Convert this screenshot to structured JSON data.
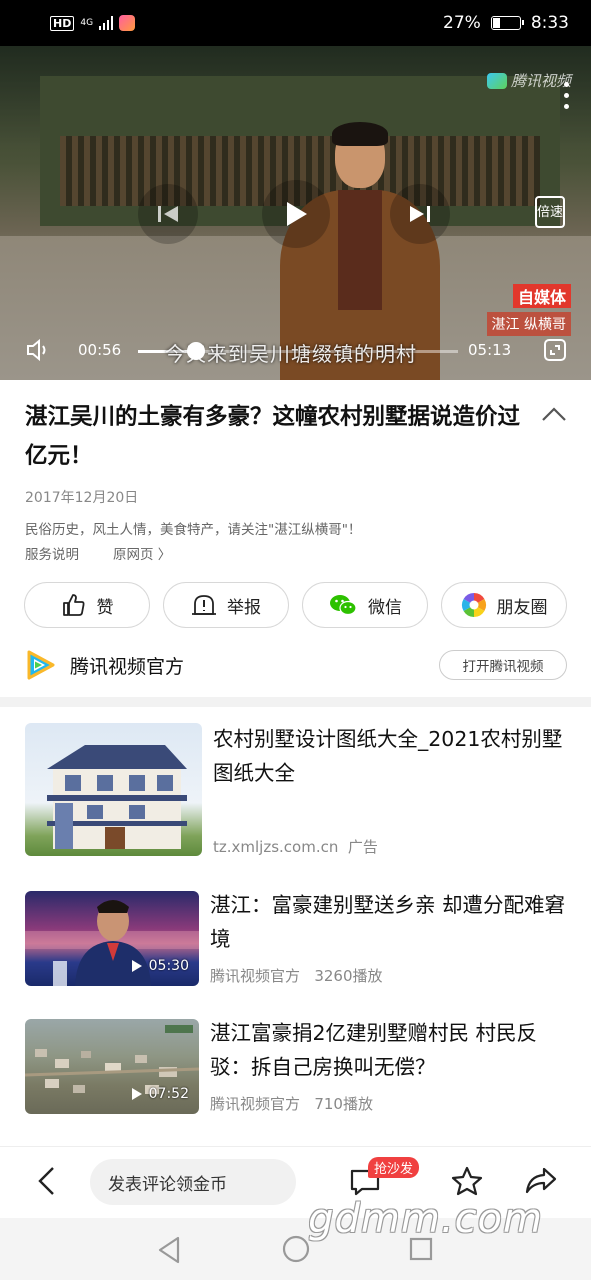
{
  "status_bar": {
    "hd": "HD",
    "network": "4G",
    "battery_text": "27%",
    "battery_level": 0.27,
    "time": "8:33"
  },
  "video": {
    "watermark": "腾讯视频",
    "speed_label": "倍速",
    "current_time": "00:56",
    "duration": "05:13",
    "progress": 0.18,
    "subtitle": "今天来到吴川塘缀镇的明村",
    "badge_top": "自媒体",
    "badge_bottom": "湛江 纵横哥"
  },
  "article": {
    "title": "湛江吴川的土豪有多豪？这幢农村别墅据说造价过亿元！",
    "date": "2017年12月20日",
    "description": "民俗历史，风土人情，美食特产，请关注\"湛江纵横哥\"！",
    "service_link": "服务说明",
    "original_link": "原网页",
    "original_chevron": "〉"
  },
  "actions": [
    {
      "label": "赞",
      "icon": "thumbs-up-icon"
    },
    {
      "label": "举报",
      "icon": "report-icon"
    },
    {
      "label": "微信",
      "icon": "wechat-icon"
    },
    {
      "label": "朋友圈",
      "icon": "moments-icon"
    }
  ],
  "source": {
    "name": "腾讯视频官方",
    "open_button": "打开腾讯视频"
  },
  "feed": [
    {
      "title": "农村别墅设计图纸大全_2021农村别墅图纸大全",
      "meta_source": "tz.xmljzs.com.cn",
      "meta_extra": "广告"
    },
    {
      "title": "湛江：富豪建别墅送乡亲 却遭分配难窘境",
      "meta_source": "腾讯视频官方",
      "meta_extra": "3260播放",
      "duration": "05:30"
    },
    {
      "title": "湛江富豪捐2亿建别墅赠村民 村民反驳：拆自己房换叫无偿？",
      "meta_source": "腾讯视频官方",
      "meta_extra": "710播放",
      "duration": "07:52"
    }
  ],
  "comment_bar": {
    "placeholder": "发表评论领金币",
    "sofa_badge": "抢沙发"
  },
  "watermark": "gdmm.com",
  "colors": {
    "accent_red": "#f04040",
    "wechat_green": "#2dc100"
  }
}
